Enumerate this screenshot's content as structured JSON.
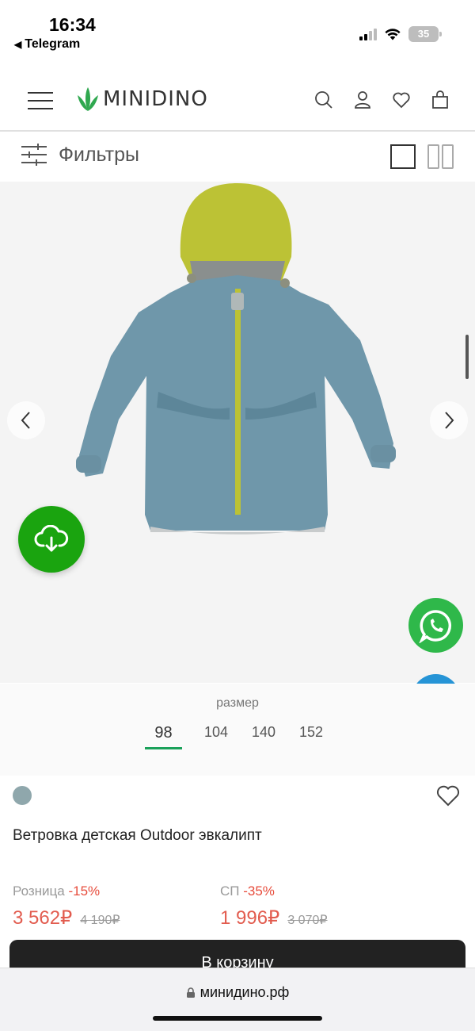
{
  "status_bar": {
    "time": "16:34",
    "back_app": "Telegram",
    "battery": "35"
  },
  "header": {
    "logo_text": "MINIDINO",
    "icons": [
      "menu-icon",
      "search-icon",
      "user-icon",
      "heart-icon",
      "bag-icon"
    ]
  },
  "filters": {
    "label": "Фильтры"
  },
  "gallery": {
    "prev_icon": "chevron-left-icon",
    "next_icon": "chevron-right-icon"
  },
  "sizes": {
    "label": "размер",
    "items": [
      "98",
      "104",
      "140",
      "152"
    ],
    "selected": "98"
  },
  "product": {
    "color": "#8fa7ac",
    "title": "Ветровка детская Outdoor эвкалипт",
    "retail": {
      "label": "Розница",
      "discount": "-15%",
      "price": "3 562₽",
      "old_price": "4 190₽"
    },
    "sp": {
      "label": "СП",
      "discount": "-35%",
      "price": "1 996₽",
      "old_price": "3 070₽"
    },
    "cart_label": "В корзину"
  },
  "browser": {
    "url": "минидино.рф"
  },
  "colors": {
    "accent_green": "#1aa40f",
    "price_red": "#e25c4f",
    "whatsapp": "#2fb84a",
    "telegram": "#2694d6"
  }
}
